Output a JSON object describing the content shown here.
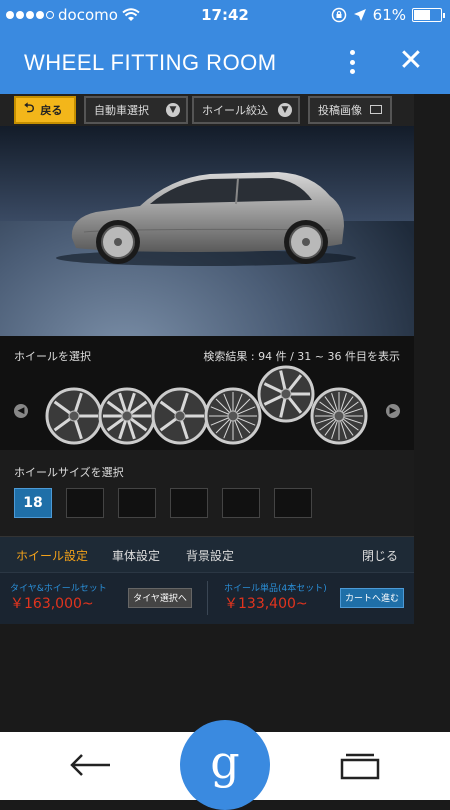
{
  "statusbar": {
    "carrier": "docomo",
    "time": "17:42",
    "battery": "61%",
    "battery_level": 0.61,
    "signal_bars": 4
  },
  "appbar": {
    "title": "WHEEL FITTING ROOM",
    "close_label": "✕"
  },
  "toolbar": {
    "back_label": "戻る",
    "car_select_label": "自動車選択",
    "wheel_filter_label": "ホイール絞込",
    "post_image_label": "投稿画像"
  },
  "wheel_panel": {
    "title": "ホイールを選択",
    "results": "検索結果 : 94 件 / 31 ~ 36 件目を表示",
    "wheel_count": 6
  },
  "size_panel": {
    "label": "ホイールサイズを選択",
    "sizes": [
      "18",
      "",
      "",
      "",
      "",
      ""
    ],
    "active_index": 0
  },
  "tabs": [
    {
      "label": "ホイール設定",
      "active": true
    },
    {
      "label": "車体設定",
      "active": false
    },
    {
      "label": "背景設定",
      "active": false
    },
    {
      "label": "閉じる",
      "active": false
    }
  ],
  "prices": {
    "set_label": "タイヤ&ホイールセット",
    "set_price": "￥163,000~",
    "set_button": "タイヤ選択へ",
    "single_label": "ホイール単品(4本セット)",
    "single_price": "￥133,400~",
    "single_button": "カートへ進む"
  },
  "colors": {
    "accent_blue": "#3a8ae0",
    "tab_active": "#f3a21a",
    "price_red": "#e1341e",
    "back_button": "#f3b61a"
  },
  "icons": [
    "wifi-icon",
    "lock-rotation-icon",
    "location-arrow-icon",
    "battery-icon",
    "more-vert-icon",
    "close-icon",
    "back-arrow-icon",
    "google-g-icon",
    "tabs-icon"
  ]
}
